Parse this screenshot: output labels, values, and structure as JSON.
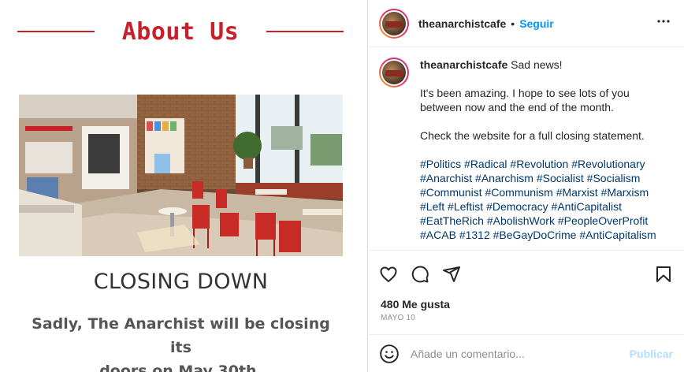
{
  "post_image": {
    "heading": "About Us",
    "closing_title": "CLOSING DOWN",
    "closing_line1": "Sadly, The Anarchist will be closing its",
    "closing_line2": "doors on May 30th.",
    "accent_color": "#c8202a"
  },
  "header": {
    "username": "theanarchistcafe",
    "separator": "•",
    "follow_label": "Seguir",
    "more_icon": "more-options-icon"
  },
  "caption": {
    "username": "theanarchistcafe",
    "first_line": "Sad news!",
    "paragraph2": "It's been amazing. I hope to see lots of you between now and the end of the month.",
    "paragraph3": "Check the website for a full closing statement.",
    "hashtags": [
      "#Politics",
      "#Radical",
      "#Revolution",
      "#Revolutionary",
      "#Anarchist",
      "#Anarchism",
      "#Socialist",
      "#Socialism",
      "#Communist",
      "#Communism",
      "#Marxist",
      "#Marxism",
      "#Left",
      "#Leftist",
      "#Democracy",
      "#AntiCapitalist",
      "#EatTheRich",
      "#AbolishWork",
      "#PeopleOverProfit",
      "#ACAB",
      "#1312",
      "#BeGayDoCrime",
      "#AntiCapitalism"
    ]
  },
  "actions": {
    "icons": [
      "heart-icon",
      "comment-icon",
      "share-icon",
      "bookmark-icon"
    ],
    "likes": "480 Me gusta",
    "date": "MAYO 10"
  },
  "comment": {
    "placeholder": "Añade un comentario...",
    "publish_label": "Publicar",
    "emoji_icon": "emoji-icon"
  },
  "colors": {
    "link_blue": "#0095f6",
    "hashtag_blue": "#00376b",
    "publish_disabled": "#b2dffc"
  }
}
